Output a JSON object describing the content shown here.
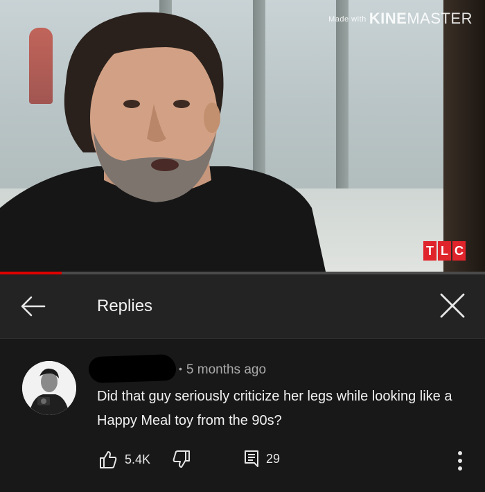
{
  "video": {
    "watermark_small": "Made with",
    "watermark_brand_bold": "KINE",
    "watermark_brand_rest": "MASTER",
    "channel_bug": [
      "T",
      "L",
      "C"
    ],
    "progress_fraction": 0.127,
    "colors": {
      "progress": "#e00000",
      "channel_bug": "#e0242c"
    }
  },
  "header": {
    "back_icon": "arrow-left-icon",
    "title": "Replies",
    "close_icon": "close-icon"
  },
  "comment": {
    "author": "",
    "time_separator": "•",
    "timestamp": "5 months ago",
    "text": "Did that guy seriously criticize her legs while looking like a Happy Meal toy from the 90s?",
    "likes": "5.4K",
    "reply_count": "29",
    "icons": {
      "like": "thumbs-up-icon",
      "dislike": "thumbs-down-icon",
      "replies": "comment-icon",
      "more": "more-vertical-icon"
    }
  }
}
